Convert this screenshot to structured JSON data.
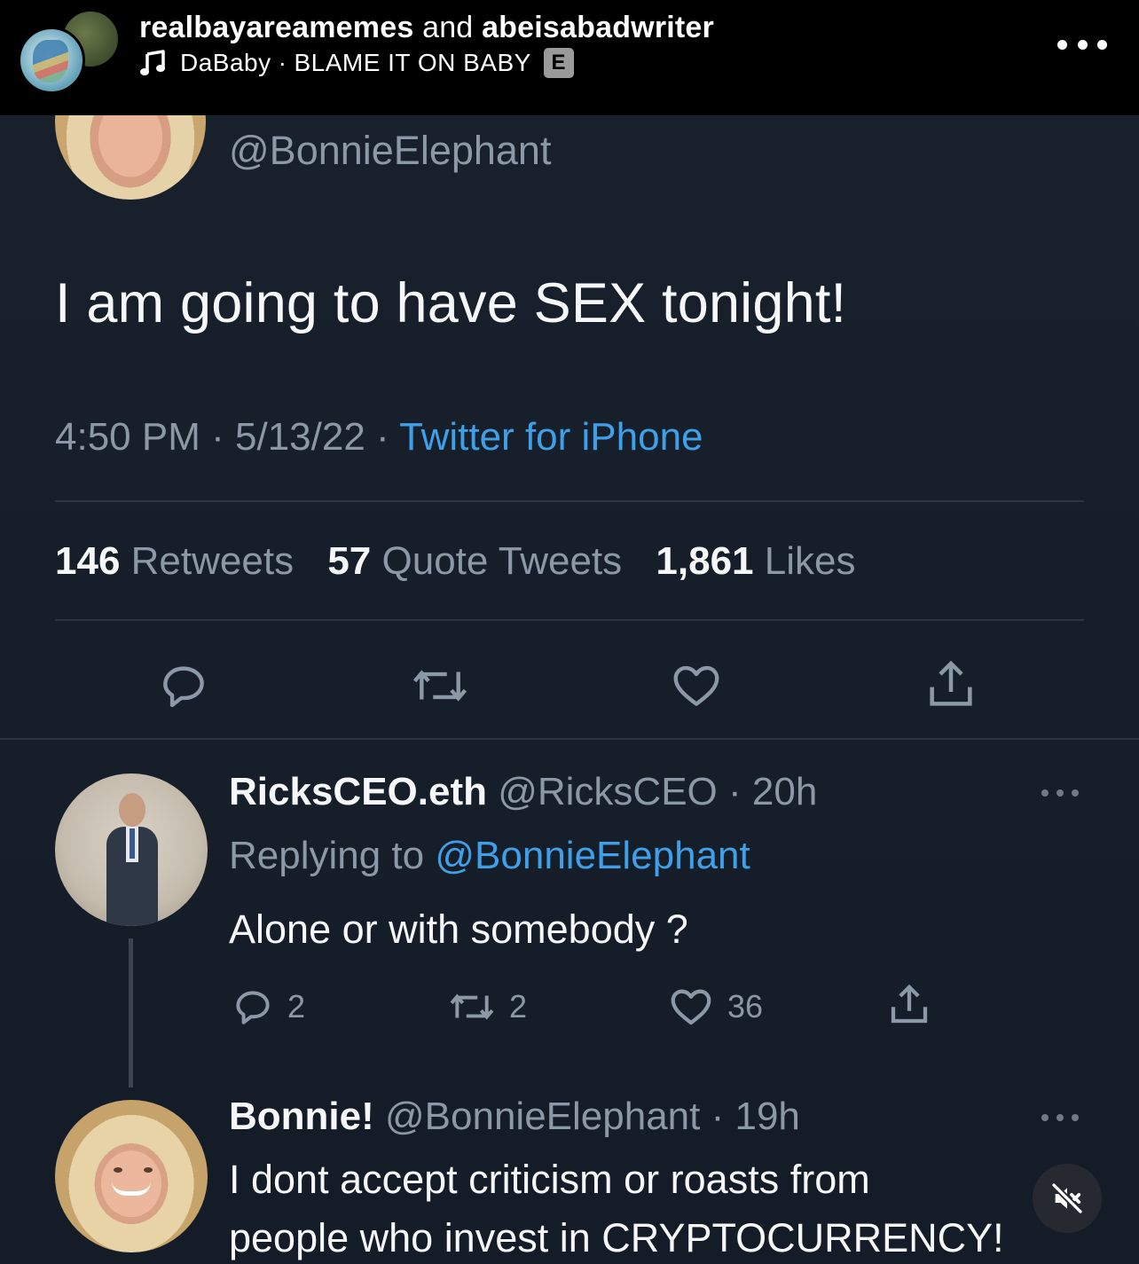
{
  "ig_header": {
    "account_1": "realbayareamemes",
    "connector": "and",
    "account_2": "abeisabadwriter",
    "music_artist": "DaBaby",
    "music_separator": "·",
    "music_track": "BLAME IT ON BABY",
    "explicit_badge": "E",
    "icons": [
      "music-note-icon",
      "more-options-icon"
    ]
  },
  "tweet": {
    "handle": "@BonnieElephant",
    "text": "I am going to have SEX tonight!",
    "time": "4:50 PM",
    "date": "5/13/22",
    "source": "Twitter for iPhone",
    "retweets_count": "146",
    "retweets_label": "Retweets",
    "quote_count": "57",
    "quote_label": "Quote Tweets",
    "likes_count": "1,861",
    "likes_label": "Likes",
    "actions": [
      "reply-icon",
      "retweet-icon",
      "like-icon",
      "share-icon"
    ]
  },
  "reply_1": {
    "name": "RicksCEO.eth",
    "handle": "@RicksCEO",
    "time": "20h",
    "replying_to_label": "Replying to",
    "replying_to_handle": "@BonnieElephant",
    "text": "Alone or with somebody ?",
    "reply_count": "2",
    "retweet_count": "2",
    "like_count": "36"
  },
  "reply_2": {
    "name": "Bonnie!",
    "handle": "@BonnieElephant",
    "time": "19h",
    "text_line_1": "I dont accept criticism or roasts from",
    "text_line_2": "people who invest in CRYPTOCURRENCY!"
  },
  "overlay": {
    "mute_icon": "muted-speaker-icon"
  },
  "colors": {
    "background": "#000000",
    "tweet_background": "#18202c",
    "primary_text": "#f5f7f8",
    "secondary_text": "#8b98a5",
    "link": "#3ea0e8"
  }
}
